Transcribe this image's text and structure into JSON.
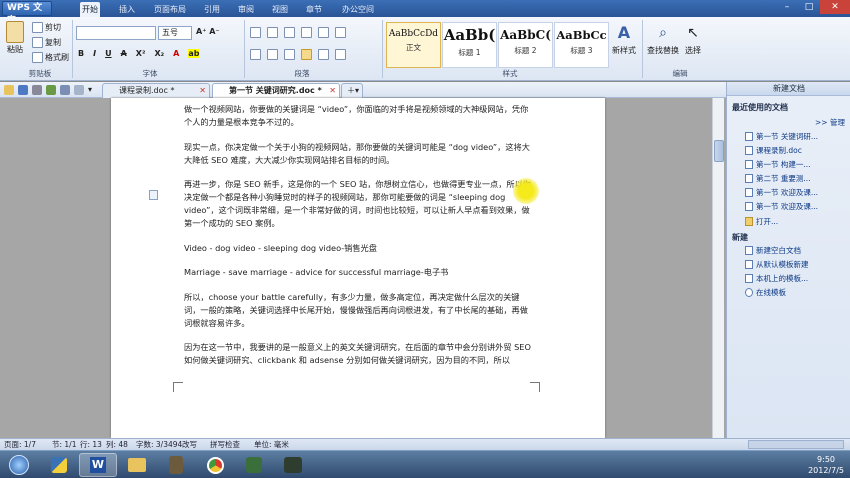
{
  "app": {
    "title": "WPS 文字"
  },
  "menu": [
    "开始",
    "插入",
    "页面布局",
    "引用",
    "审阅",
    "视图",
    "章节",
    "办公空间"
  ],
  "ribbon": {
    "paste": "粘贴",
    "cut": "剪切",
    "copy": "复制",
    "format_painter": "格式刷",
    "clipboard_label": "剪贴板",
    "font_name": "",
    "font_size": "五号",
    "font_label": "字体",
    "para_label": "段落",
    "styles": [
      {
        "sample": "AaBbCcDd",
        "name": "正文"
      },
      {
        "sample": "AaBb(",
        "name": "标题 1"
      },
      {
        "sample": "AaBbC(",
        "name": "标题 2"
      },
      {
        "sample": "AaBbCc",
        "name": "标题 3"
      }
    ],
    "style_label": "样式",
    "new_style": "新样式",
    "find_replace": "查找替换",
    "select": "选择",
    "edit_label": "编辑"
  },
  "tabs": [
    {
      "label": "课程录制.doc *",
      "active": false
    },
    {
      "label": "第一节 关键词研究.doc *",
      "active": true
    }
  ],
  "document": {
    "paragraphs": [
      "做一个视频网站，你要做的关键词是 “video”，你面临的对手将是视频领域的大神级网站，凭你个人的力量是根本竞争不过的。",
      "现实一点，你决定做一个关于小狗的视频网站，那你要做的关键词可能是 “dog video”，这将大大降低 SEO 难度，大大减少你实现网站排名目标的时间。",
      "再进一步，你是 SEO 新手，这是你的一个 SEO 站，你想树立信心，也做得更专业一点，所以你决定做一个都是各种小狗睡觉时的样子的视频网站，那你可能要做的词是 “sleeping dog video”，这个词既非常细，是一个非常好做的词，时间也比较短，可以让新人早点看到效果，做第一个成功的 SEO 案例。",
      "Video - dog video - sleeping dog video-销售光盘",
      "Marriage - save marriage - advice for successful marriage-电子书",
      "所以，choose your battle carefully，有多少力量，做多高定位，再决定做什么层次的关键词，一般的策略，关键词选择中长尾开始，慢慢做强后再向词根进发，有了中长尾的基础，再做词根就容易许多。",
      "因为在这一节中，我要讲的是一般意义上的英文关键词研究，在后面的章节中会分别讲外贸 SEO 如何做关键词研究、clickbank 和 adsense 分别如何做关键词研究，因为目的不同，所以"
    ]
  },
  "panel": {
    "title": "新建文档",
    "recent_label": "最近使用的文档",
    "manage": ">> 管理",
    "recent": [
      "第一节 关键词研...",
      "课程录制.doc",
      "第一节 构建一...",
      "第二节 重要测...",
      "第一节 欢迎及课...",
      "第一节 欢迎及课..."
    ],
    "open": "打开...",
    "new_label": "新建",
    "new_items": [
      "新建空白文档",
      "从默认模板新建",
      "本机上的模板...",
      "在线模板"
    ]
  },
  "status": {
    "page": "页面: 1/7",
    "section": "节: 1/1",
    "row": "行: 13",
    "col": "列: 48",
    "words": "字数: 3/3494",
    "revise": "改写",
    "spell": "拼写检查",
    "unit": "单位: 毫米"
  },
  "clock": {
    "time": "9:50",
    "date": "2012/7/5"
  },
  "colors": {
    "accent": "#2a5496",
    "highlight": "#b9d6f5",
    "cursor_glow": "#f2e600"
  }
}
